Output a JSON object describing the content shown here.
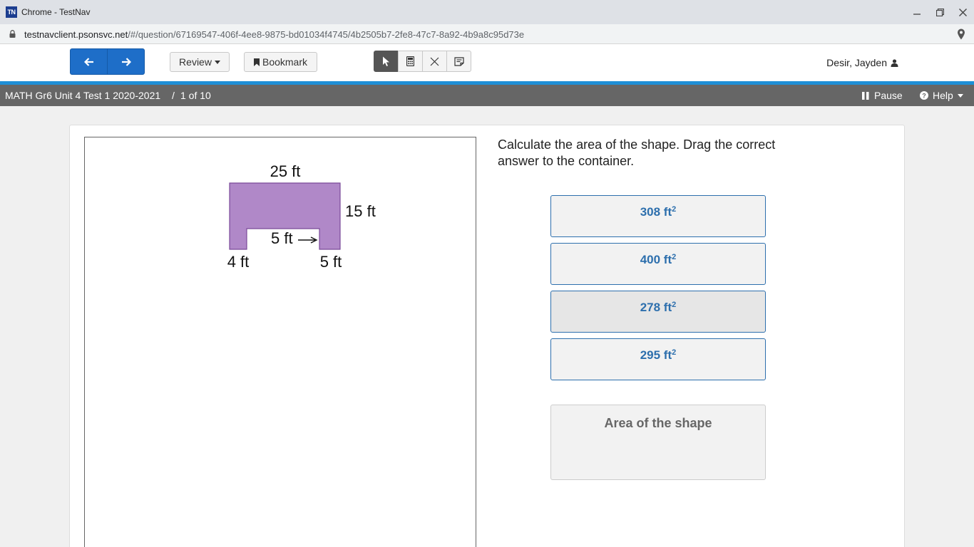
{
  "window": {
    "app_icon": "TN",
    "title": "Chrome - TestNav",
    "controls": [
      "minimize-icon",
      "restore-icon",
      "close-icon"
    ]
  },
  "address": {
    "host": "testnavclient.psonsvc.net",
    "path": "/#/question/67169547-406f-4ee8-9875-bd01034f4745/4b2505b7-2fe8-47c7-8a92-4b9a8c95d73e"
  },
  "toolbar": {
    "review_label": "Review",
    "bookmark_label": "Bookmark",
    "tools": [
      "pointer-icon",
      "calculator-icon",
      "eliminator-icon",
      "notes-icon"
    ],
    "user_name": "Desir, Jayden"
  },
  "testbar": {
    "test_name": "MATH Gr6 Unit 4 Test 1 2020-2021",
    "separator": "/",
    "progress": "1 of 10",
    "pause_label": "Pause",
    "help_label": "Help"
  },
  "figure": {
    "top_label": "25 ft",
    "right_label": "15 ft",
    "notch_label": "5 ft",
    "left_leg_label": "4 ft",
    "right_leg_label": "5 ft",
    "fill_color": "#b088c8",
    "stroke_color": "#7a4a99"
  },
  "question": {
    "text": "Calculate the area of the shape.  Drag the correct answer to the container."
  },
  "answers": [
    {
      "value": "308 ft",
      "exp": "2"
    },
    {
      "value": "400 ft",
      "exp": "2"
    },
    {
      "value": "278 ft",
      "exp": "2"
    },
    {
      "value": "295 ft",
      "exp": "2"
    }
  ],
  "dropzone": {
    "label": "Area of the shape"
  },
  "colors": {
    "accent": "#1e8fd6",
    "nav_button": "#1e6ec8",
    "answer_text": "#2d6fad"
  }
}
